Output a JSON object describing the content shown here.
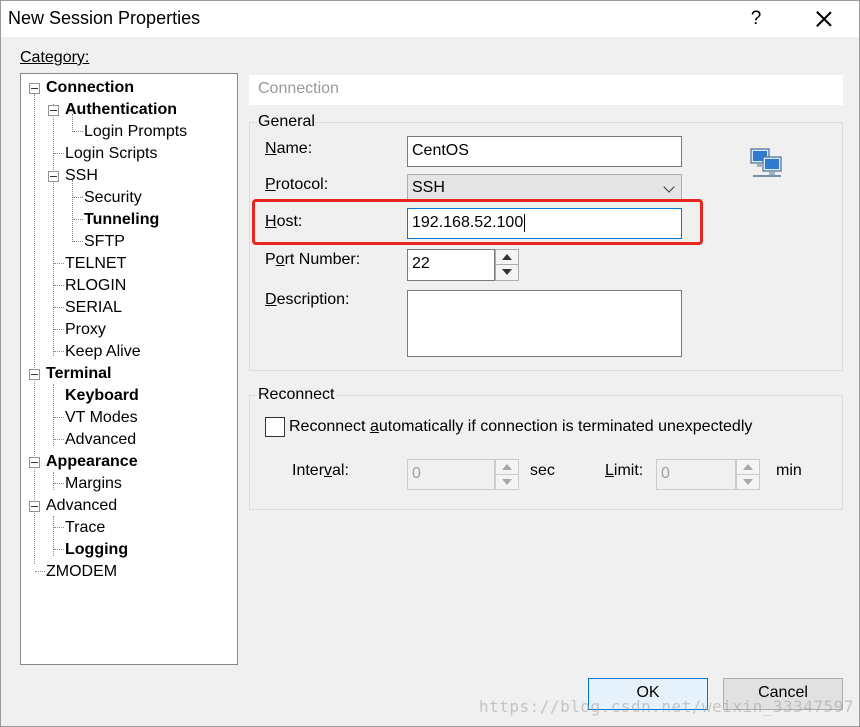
{
  "window": {
    "title": "New Session Properties",
    "help_glyph": "?"
  },
  "category": {
    "label": "Category:",
    "tree": [
      {
        "label": "Connection",
        "bold": true
      },
      {
        "label": "Authentication",
        "bold": true
      },
      {
        "label": "Login Prompts",
        "bold": false
      },
      {
        "label": "Login Scripts",
        "bold": false
      },
      {
        "label": "SSH",
        "bold": false
      },
      {
        "label": "Security",
        "bold": false
      },
      {
        "label": "Tunneling",
        "bold": true
      },
      {
        "label": "SFTP",
        "bold": false
      },
      {
        "label": "TELNET",
        "bold": false
      },
      {
        "label": "RLOGIN",
        "bold": false
      },
      {
        "label": "SERIAL",
        "bold": false
      },
      {
        "label": "Proxy",
        "bold": false
      },
      {
        "label": "Keep Alive",
        "bold": false
      },
      {
        "label": "Terminal",
        "bold": true
      },
      {
        "label": "Keyboard",
        "bold": true
      },
      {
        "label": "VT Modes",
        "bold": false
      },
      {
        "label": "Advanced",
        "bold": false
      },
      {
        "label": "Appearance",
        "bold": true
      },
      {
        "label": "Margins",
        "bold": false
      },
      {
        "label": "Advanced",
        "bold": false
      },
      {
        "label": "Trace",
        "bold": false
      },
      {
        "label": "Logging",
        "bold": true
      },
      {
        "label": "ZMODEM",
        "bold": false
      }
    ]
  },
  "panel": {
    "header": "Connection",
    "general": {
      "label": "General",
      "name": {
        "label_u": "N",
        "label_rest": "ame:",
        "value": "CentOS"
      },
      "protocol": {
        "label_u": "P",
        "label_rest": "rotocol:",
        "value": "SSH"
      },
      "host": {
        "label_u": "H",
        "label_rest": "ost:",
        "value": "192.168.52.100"
      },
      "port": {
        "label_pre": "P",
        "label_u": "o",
        "label_rest": "rt Number:",
        "value": "22"
      },
      "description": {
        "label_u": "D",
        "label_rest": "escription:",
        "value": ""
      }
    },
    "reconnect": {
      "label": "Reconnect",
      "checkbox_pre": "Reconnect ",
      "checkbox_u": "a",
      "checkbox_rest": "utomatically if connection is terminated unexpectedly",
      "interval": {
        "label_pre": "Inter",
        "label_u": "v",
        "label_rest": "al:",
        "value": "0",
        "unit": "sec"
      },
      "limit": {
        "label_u": "L",
        "label_rest": "imit:",
        "value": "0",
        "unit": "min"
      }
    }
  },
  "buttons": {
    "ok": "OK",
    "cancel": "Cancel"
  },
  "watermark": "https://blog.csdn.net/weixin_33347597",
  "colors": {
    "highlight": "#e8261f",
    "focus": "#0078d7"
  },
  "icons": {
    "session": "network-computers-icon"
  }
}
